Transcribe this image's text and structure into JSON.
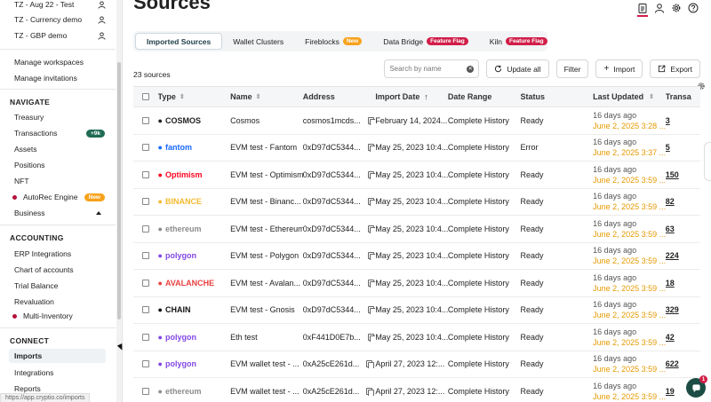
{
  "sidebar": {
    "workspaces": [
      {
        "name": "TZ - Aug 22 - Test"
      },
      {
        "name": "TZ - Currency demo"
      },
      {
        "name": "TZ - GBP demo"
      }
    ],
    "links": [
      "Manage workspaces",
      "Manage invitations"
    ],
    "navigate": {
      "heading": "NAVIGATE",
      "items": [
        {
          "label": "Treasury"
        },
        {
          "label": "Transactions",
          "badge": "+9k"
        },
        {
          "label": "Assets"
        },
        {
          "label": "Positions"
        },
        {
          "label": "NFT"
        },
        {
          "label": "AutoRec Engine",
          "badge": "New"
        },
        {
          "label": "Business"
        }
      ]
    },
    "accounting": {
      "heading": "ACCOUNTING",
      "items": [
        {
          "label": "ERP Integrations"
        },
        {
          "label": "Chart of accounts"
        },
        {
          "label": "Trial Balance"
        },
        {
          "label": "Revaluation"
        },
        {
          "label": "Multi-Inventory"
        }
      ]
    },
    "connect": {
      "heading": "CONNECT",
      "items": [
        {
          "label": "Imports"
        },
        {
          "label": "Integrations"
        },
        {
          "label": "Reports"
        }
      ]
    },
    "status_url": "https://app.cryptio.co/imports"
  },
  "header": {
    "title": "Sources"
  },
  "tabs": [
    {
      "label": "Imported Sources",
      "active": true
    },
    {
      "label": "Wallet Clusters"
    },
    {
      "label": "Fireblocks",
      "pill": "New"
    },
    {
      "label": "Data Bridge",
      "pill": "Feature Flag"
    },
    {
      "label": "Kiln",
      "pill": "Feature Flag"
    }
  ],
  "toolbar": {
    "count": "23 sources",
    "search_placeholder": "Search by name",
    "update_all": "Update all",
    "filter": "Filter",
    "import": "Import",
    "export": "Export"
  },
  "table": {
    "columns": [
      "Type",
      "Name",
      "Address",
      "Import Date",
      "Date Range",
      "Status",
      "Last Updated",
      "Transa"
    ],
    "rows": [
      {
        "logo": "COSMOS",
        "logo_color": "#222222",
        "name": "Cosmos",
        "address": "cosmos1mcds...",
        "import_date": "February 14, 2024...",
        "range": "Complete History",
        "status": "Ready",
        "upd1": "16 days ago",
        "upd2": "June 2, 2025 3:28 ...",
        "tx": "3"
      },
      {
        "logo": "fantom",
        "logo_color": "#1969ff",
        "name": "EVM test - Fantom",
        "address": "0xD97dC5344...",
        "import_date": "May 25, 2023 10:4...",
        "range": "Complete History",
        "status": "Error",
        "upd1": "16 days ago",
        "upd2": "June 2, 2025 3:37 ...",
        "tx": "5"
      },
      {
        "logo": "Optimism",
        "logo_color": "#ff0420",
        "name": "EVM test - Optimism",
        "address": "0xD97dC5344...",
        "import_date": "May 25, 2023 10:4...",
        "range": "Complete History",
        "status": "Ready",
        "upd1": "16 days ago",
        "upd2": "June 2, 2025 3:59 ...",
        "tx": "150"
      },
      {
        "logo": "BINANCE",
        "logo_color": "#f3ba2f",
        "name": "EVM test - Binanc...",
        "address": "0xD97dC5344...",
        "import_date": "May 25, 2023 10:4...",
        "range": "Complete History",
        "status": "Ready",
        "upd1": "16 days ago",
        "upd2": "June 2, 2025 3:59 ...",
        "tx": "82"
      },
      {
        "logo": "ethereum",
        "logo_color": "#8c8c8c",
        "name": "EVM test - Ethereum",
        "address": "0xD97dC5344...",
        "import_date": "May 25, 2023 10:4...",
        "range": "Complete History",
        "status": "Ready",
        "upd1": "16 days ago",
        "upd2": "June 2, 2025 3:59 ...",
        "tx": "63"
      },
      {
        "logo": "polygon",
        "logo_color": "#8247e5",
        "name": "EVM test - Polygon",
        "address": "0xD97dC5344...",
        "import_date": "May 25, 2023 10:4...",
        "range": "Complete History",
        "status": "Ready",
        "upd1": "16 days ago",
        "upd2": "June 2, 2025 3:59 ...",
        "tx": "224"
      },
      {
        "logo": "AVALANCHE",
        "logo_color": "#e84142",
        "name": "EVM test - Avalan...",
        "address": "0xD97dC5344...",
        "import_date": "May 25, 2023 10:4...",
        "range": "Complete History",
        "status": "Ready",
        "upd1": "16 days ago",
        "upd2": "June 2, 2025 3:59 ...",
        "tx": "18"
      },
      {
        "logo": "CHAIN",
        "logo_color": "#111111",
        "name": "EVM test - Gnosis",
        "address": "0xD97dC5344...",
        "import_date": "May 25, 2023 10:4...",
        "range": "Complete History",
        "status": "Ready",
        "upd1": "16 days ago",
        "upd2": "June 2, 2025 3:59 ...",
        "tx": "329"
      },
      {
        "logo": "polygon",
        "logo_color": "#8247e5",
        "name": "Eth test",
        "address": "0xF441D0E7b...",
        "import_date": "May 25, 2023 10:4...",
        "range": "Complete History",
        "status": "Ready",
        "upd1": "16 days ago",
        "upd2": "June 2, 2025 3:59 ...",
        "tx": "42"
      },
      {
        "logo": "polygon",
        "logo_color": "#8247e5",
        "name": "EVM wallet test - ...",
        "address": "0xA25cE261d...",
        "import_date": "April 27, 2023 12:...",
        "range": "Complete History",
        "status": "Ready",
        "upd1": "16 days ago",
        "upd2": "June 2, 2025 3:59 ...",
        "tx": "622"
      },
      {
        "logo": "ethereum",
        "logo_color": "#8c8c8c",
        "name": "EVM wallet test - ...",
        "address": "0xA25cE261d...",
        "import_date": "April 27, 2023 12:...",
        "range": "Complete History",
        "status": "Ready",
        "upd1": "16 days ago",
        "upd2": "June 2, 2025 3:59 ...",
        "tx": "19"
      }
    ]
  },
  "chat": {
    "badge": "1"
  }
}
